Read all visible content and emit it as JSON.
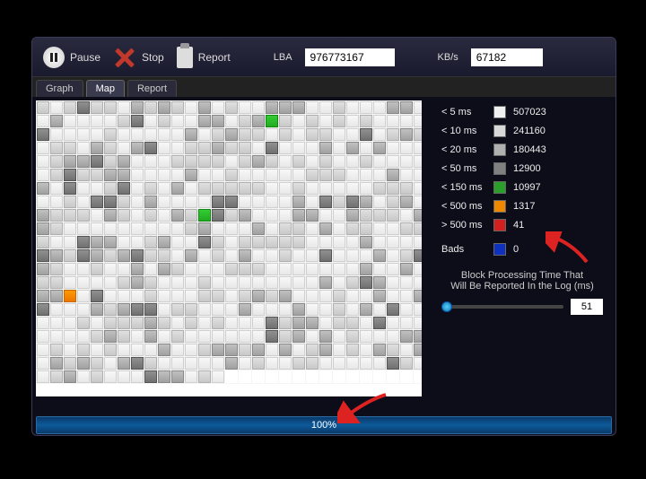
{
  "toolbar": {
    "pause": "Pause",
    "stop": "Stop",
    "report": "Report",
    "lba_label": "LBA",
    "lba_value": "976773167",
    "kbs_label": "KB/s",
    "kbs_value": "67182"
  },
  "tabs": {
    "graph": "Graph",
    "map": "Map",
    "report": "Report",
    "active": "map"
  },
  "legend": {
    "rows": [
      {
        "label": "< 5 ms",
        "color": "#f0f0f0",
        "count": "507023"
      },
      {
        "label": "< 10 ms",
        "color": "#d8d8d8",
        "count": "241160"
      },
      {
        "label": "< 20 ms",
        "color": "#b0b0b0",
        "count": "180443"
      },
      {
        "label": "< 50 ms",
        "color": "#808080",
        "count": "12900"
      },
      {
        "label": "< 150 ms",
        "color": "#2a9d2a",
        "count": "10997"
      },
      {
        "label": "< 500 ms",
        "color": "#ee8800",
        "count": "1317"
      },
      {
        "label": "> 500 ms",
        "color": "#d02020",
        "count": "41"
      }
    ],
    "bads_label": "Bads",
    "bads_color": "#1030c0",
    "bads_count": "0"
  },
  "slider": {
    "title1": "Block Processing Time That",
    "title2": "Will Be Reported In the Log (ms)",
    "value": "51"
  },
  "progress": {
    "text": "100%"
  },
  "grid": {
    "cols": 29,
    "rows": 21,
    "special": [
      {
        "r": 1,
        "c": 17,
        "cls": "c-green"
      },
      {
        "r": 8,
        "c": 12,
        "cls": "c-green"
      },
      {
        "r": 14,
        "c": 2,
        "cls": "c-orange"
      }
    ],
    "empty_tail_start": {
      "r": 20,
      "c": 14
    }
  }
}
